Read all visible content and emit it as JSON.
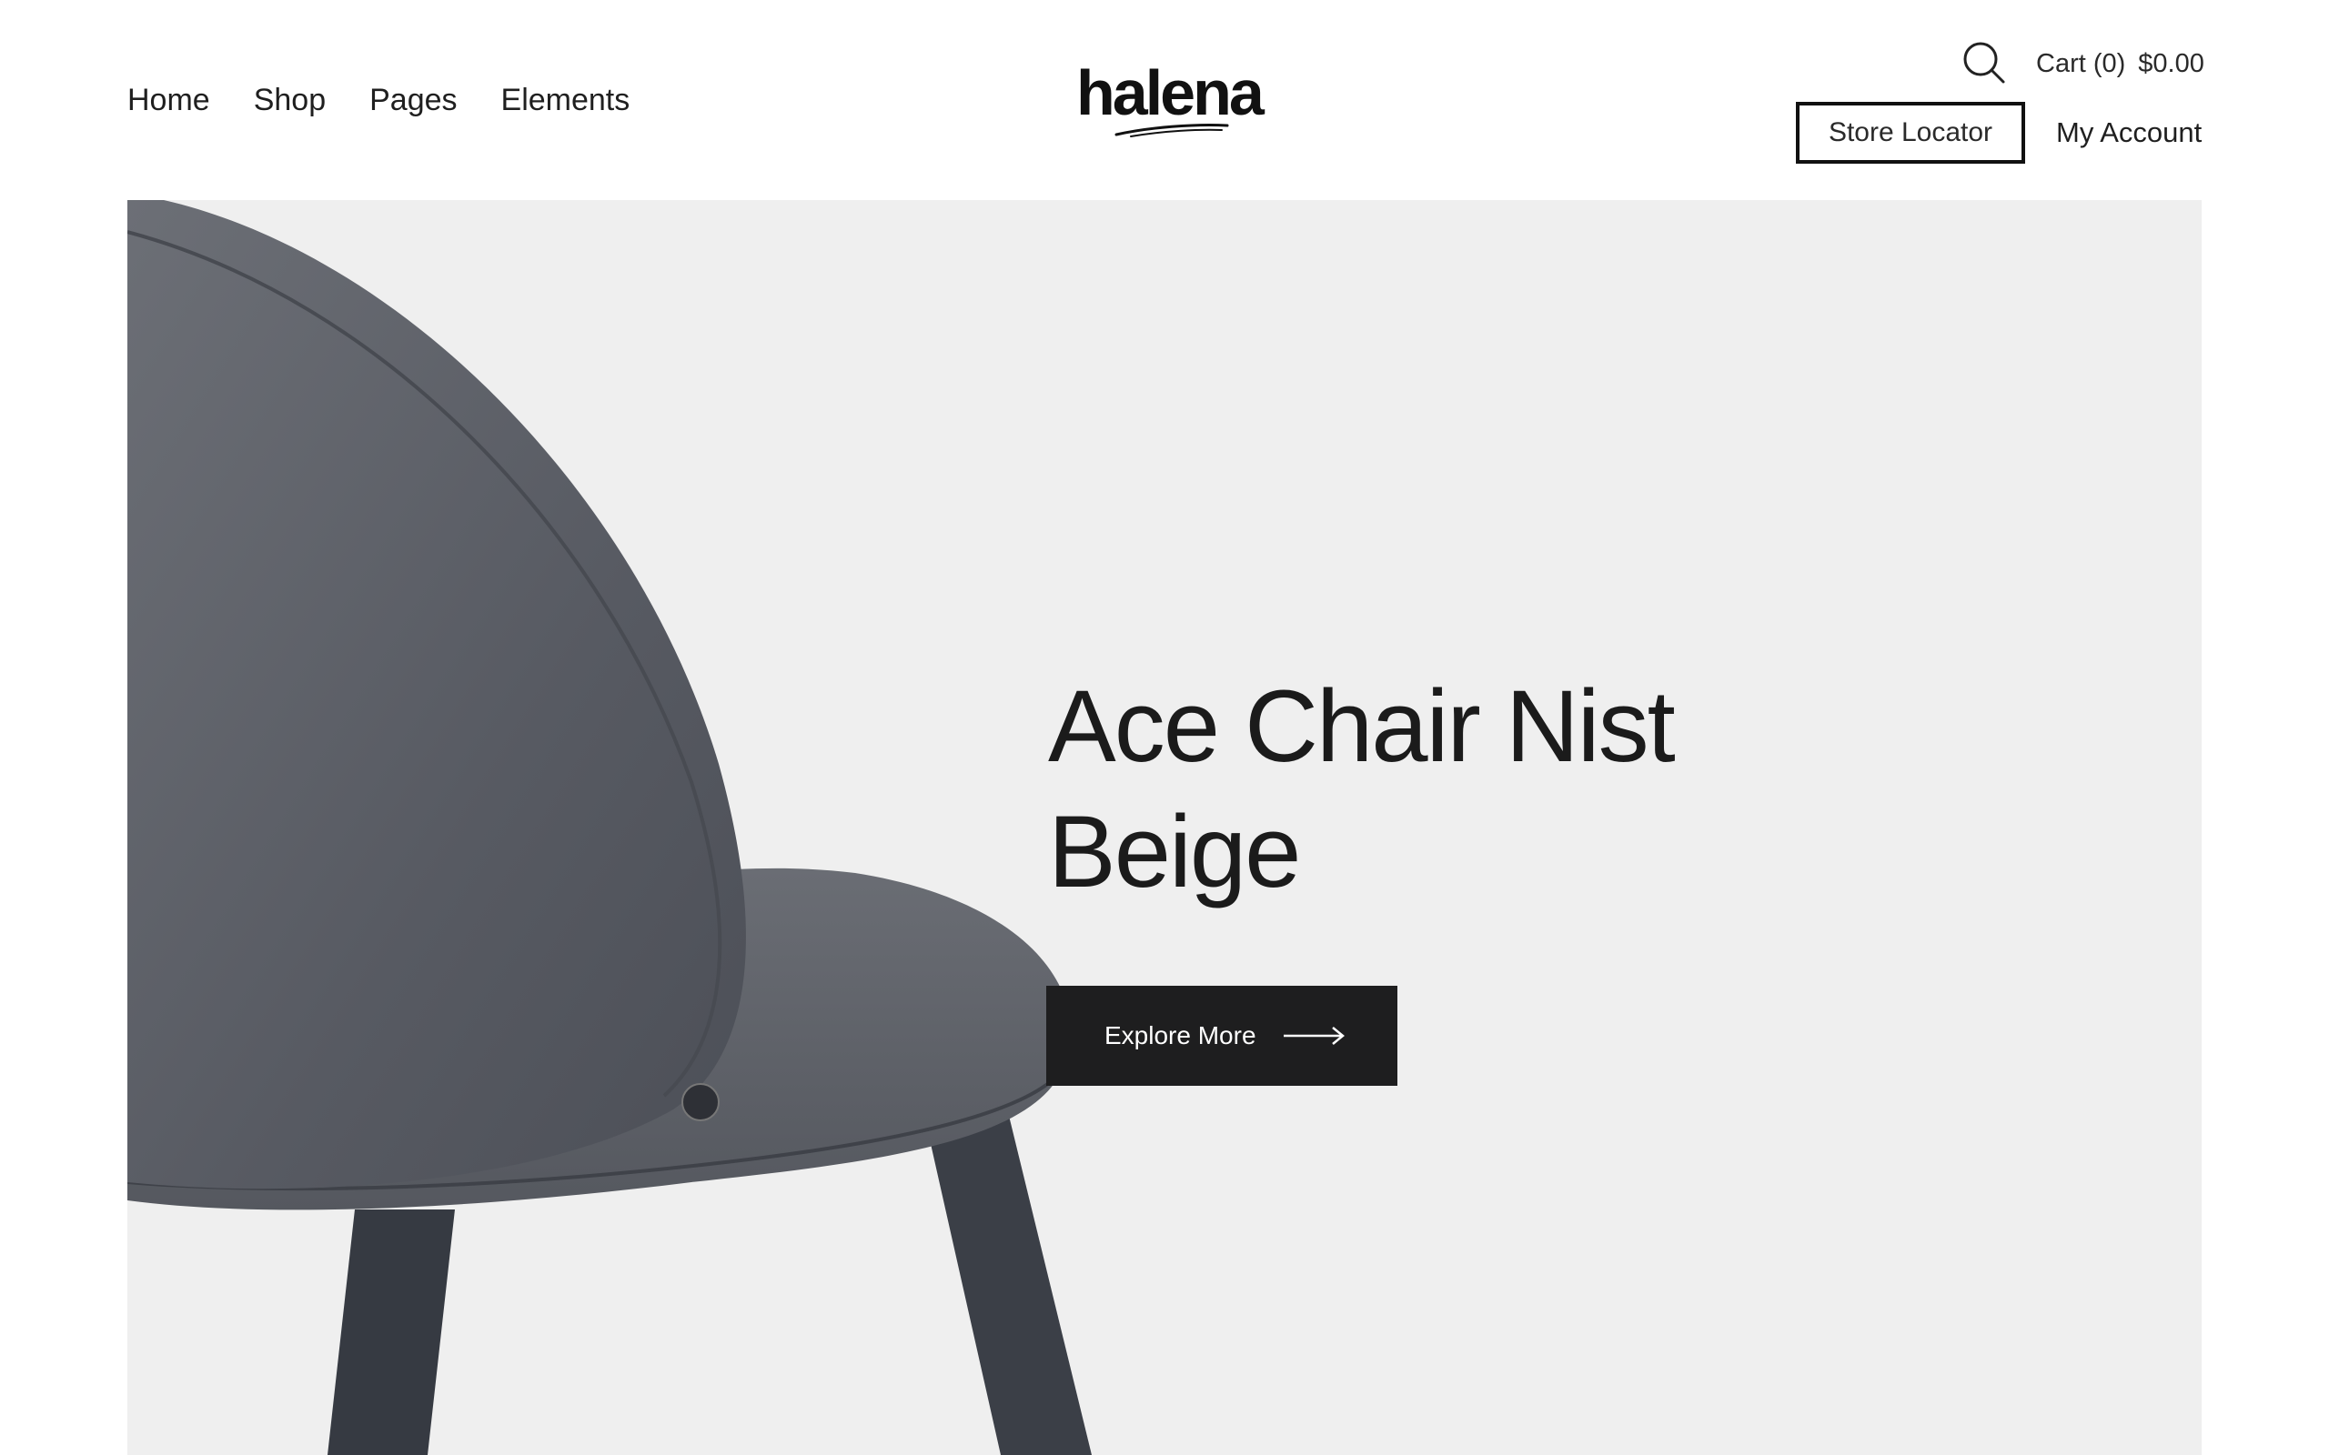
{
  "header": {
    "nav": [
      "Home",
      "Shop",
      "Pages",
      "Elements"
    ],
    "logo": "halena",
    "icons": {
      "search": "search-icon"
    },
    "cart": {
      "label": "Cart (0)",
      "total": "$0.00"
    },
    "store_locator": "Store Locator",
    "my_account": "My Account"
  },
  "hero": {
    "title_line1": "Ace Chair Nist",
    "title_line2": "Beige",
    "button_label": "Explore More",
    "button_icon": "arrow-right-icon"
  },
  "colors": {
    "hero_bg": "#efefef",
    "button_bg": "#1e1e1f",
    "text": "#1f1f1f"
  }
}
